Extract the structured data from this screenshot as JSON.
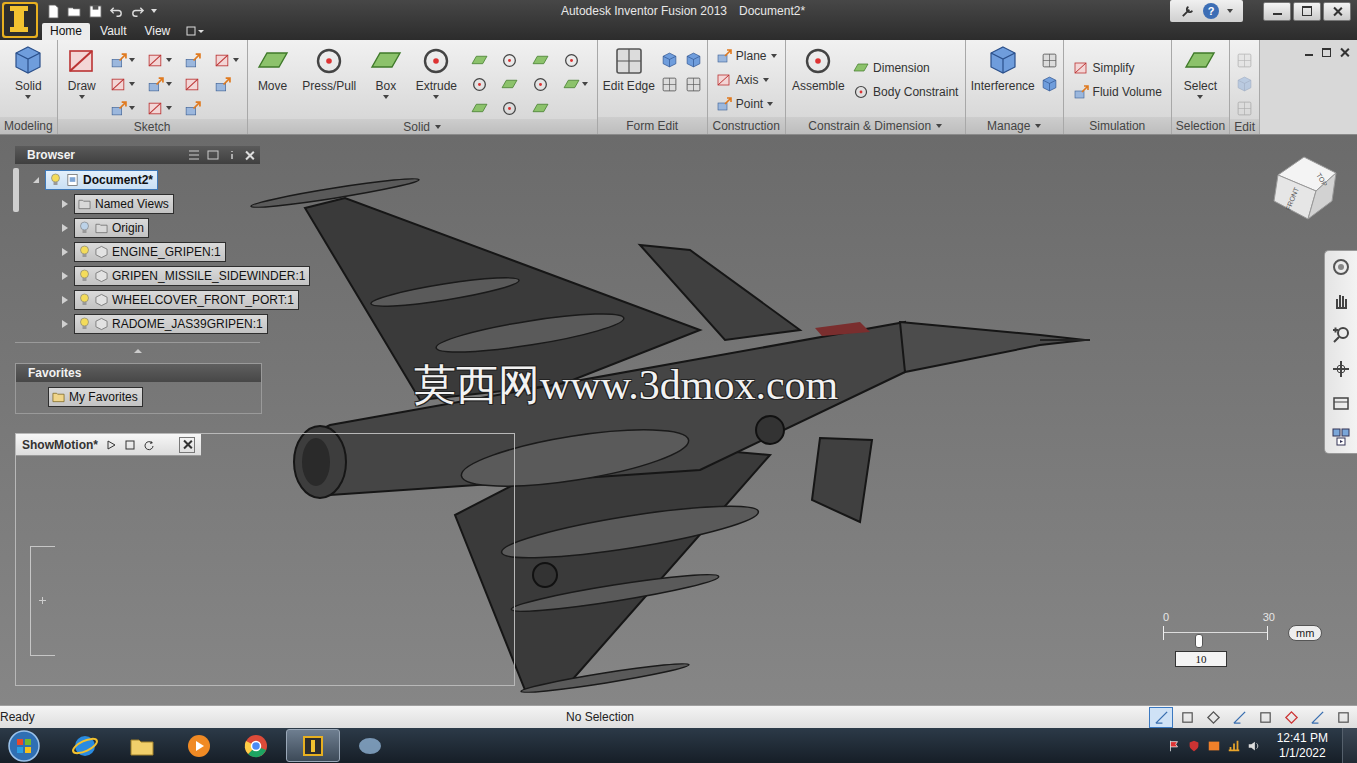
{
  "window": {
    "title": "Autodesk Inventor Fusion 2013",
    "document": "Document2*",
    "help": "?"
  },
  "tabs": [
    {
      "label": "Home",
      "selected": true
    },
    {
      "label": "Vault",
      "selected": false
    },
    {
      "label": "View",
      "selected": false
    }
  ],
  "ribbon": [
    {
      "label": "Modeling",
      "menu": false,
      "buttons": [
        {
          "kind": "large",
          "label": "Solid",
          "dropdown": true,
          "disabled": false
        }
      ]
    },
    {
      "label": "Sketch",
      "menu": false,
      "buttons": [
        {
          "kind": "large",
          "label": "Draw",
          "dropdown": true,
          "disabled": false
        },
        {
          "kind": "icon",
          "dropdown": true,
          "disabled": false
        },
        {
          "kind": "icon",
          "dropdown": true,
          "disabled": false
        },
        {
          "kind": "icon",
          "dropdown": true,
          "disabled": false
        },
        {
          "kind": "icon",
          "dropdown": true,
          "disabled": false
        },
        {
          "kind": "icon",
          "dropdown": true,
          "disabled": false
        },
        {
          "kind": "icon",
          "dropdown": true,
          "disabled": false
        },
        {
          "kind": "icon",
          "dropdown": false,
          "disabled": false
        },
        {
          "kind": "icon",
          "dropdown": false,
          "disabled": false
        },
        {
          "kind": "icon",
          "dropdown": false,
          "disabled": false
        },
        {
          "kind": "icon",
          "dropdown": true,
          "disabled": false
        },
        {
          "kind": "icon",
          "dropdown": false,
          "disabled": false
        }
      ]
    },
    {
      "label": "Solid",
      "menu": true,
      "buttons": [
        {
          "kind": "large",
          "label": "Move",
          "dropdown": false,
          "disabled": false
        },
        {
          "kind": "large",
          "label": "Press/Pull",
          "dropdown": false,
          "disabled": false
        },
        {
          "kind": "large",
          "label": "Box",
          "dropdown": true,
          "disabled": false
        },
        {
          "kind": "large",
          "label": "Extrude",
          "dropdown": true,
          "disabled": false
        },
        {
          "kind": "icon",
          "dropdown": false,
          "disabled": false
        },
        {
          "kind": "icon",
          "dropdown": false,
          "disabled": false
        },
        {
          "kind": "icon",
          "dropdown": false,
          "disabled": false
        },
        {
          "kind": "icon",
          "dropdown": false,
          "disabled": false
        },
        {
          "kind": "icon",
          "dropdown": false,
          "disabled": false
        },
        {
          "kind": "icon",
          "dropdown": false,
          "disabled": false
        },
        {
          "kind": "icon",
          "dropdown": false,
          "disabled": false
        },
        {
          "kind": "icon",
          "dropdown": false,
          "disabled": false
        },
        {
          "kind": "icon",
          "dropdown": false,
          "disabled": false
        },
        {
          "kind": "icon",
          "dropdown": false,
          "disabled": false
        },
        {
          "kind": "icon",
          "dropdown": true,
          "disabled": false
        }
      ]
    },
    {
      "label": "Form Edit",
      "menu": false,
      "buttons": [
        {
          "kind": "large",
          "label": "Edit Edge",
          "dropdown": false,
          "disabled": false
        },
        {
          "kind": "icon",
          "dropdown": false,
          "disabled": false
        },
        {
          "kind": "icon",
          "dropdown": false,
          "disabled": false
        },
        {
          "kind": "icon",
          "dropdown": false,
          "disabled": false
        },
        {
          "kind": "icon",
          "dropdown": false,
          "disabled": false
        }
      ]
    },
    {
      "label": "Construction",
      "menu": false,
      "buttons": [
        {
          "kind": "small",
          "label": "Plane",
          "dropdown": true,
          "disabled": false
        },
        {
          "kind": "small",
          "label": "Axis",
          "dropdown": true,
          "disabled": false
        },
        {
          "kind": "small",
          "label": "Point",
          "dropdown": true,
          "disabled": false
        }
      ]
    },
    {
      "label": "Constrain & Dimension",
      "menu": true,
      "buttons": [
        {
          "kind": "large",
          "label": "Assemble",
          "dropdown": false,
          "disabled": false
        },
        {
          "kind": "small",
          "label": "Dimension",
          "dropdown": false,
          "disabled": false
        },
        {
          "kind": "small",
          "label": "Body Constraint",
          "dropdown": false,
          "disabled": false
        }
      ]
    },
    {
      "label": "Manage",
      "menu": true,
      "buttons": [
        {
          "kind": "large",
          "label": "Interference",
          "dropdown": false,
          "disabled": false
        },
        {
          "kind": "icon",
          "dropdown": false,
          "disabled": false
        },
        {
          "kind": "icon",
          "dropdown": false,
          "disabled": false
        }
      ]
    },
    {
      "label": "Simulation",
      "menu": false,
      "buttons": [
        {
          "kind": "small",
          "label": "Simplify",
          "dropdown": false,
          "disabled": false
        },
        {
          "kind": "small",
          "label": "Fluid Volume",
          "dropdown": false,
          "disabled": false
        }
      ]
    },
    {
      "label": "Selection",
      "menu": false,
      "buttons": [
        {
          "kind": "large",
          "label": "Select",
          "dropdown": true,
          "disabled": false
        }
      ]
    },
    {
      "label": "Edit",
      "menu": false,
      "buttons": [
        {
          "kind": "icon",
          "dropdown": false,
          "disabled": true
        },
        {
          "kind": "icon",
          "dropdown": false,
          "disabled": true
        },
        {
          "kind": "icon",
          "dropdown": false,
          "disabled": true
        }
      ]
    }
  ],
  "browser": {
    "title": "Browser",
    "items": [
      {
        "label": "Document2*",
        "level": 0,
        "kind": "document",
        "expanded": true,
        "selected": true,
        "has_bulb": true,
        "visible": true
      },
      {
        "label": "Named Views",
        "level": 1,
        "kind": "folder",
        "expanded": false,
        "selected": false,
        "has_bulb": false,
        "visible": true
      },
      {
        "label": "Origin",
        "level": 1,
        "kind": "folder",
        "expanded": false,
        "selected": false,
        "has_bulb": true,
        "visible": false
      },
      {
        "label": "ENGINE_GRIPEN:1",
        "level": 1,
        "kind": "part",
        "expanded": false,
        "selected": false,
        "has_bulb": true,
        "visible": true
      },
      {
        "label": "GRIPEN_MISSILE_SIDEWINDER:1",
        "level": 1,
        "kind": "part",
        "expanded": false,
        "selected": false,
        "has_bulb": true,
        "visible": true
      },
      {
        "label": "WHEELCOVER_FRONT_PORT:1",
        "level": 1,
        "kind": "part",
        "expanded": false,
        "selected": false,
        "has_bulb": true,
        "visible": true
      },
      {
        "label": "RADOME_JAS39GRIPEN:1",
        "level": 1,
        "kind": "part",
        "expanded": false,
        "selected": false,
        "has_bulb": true,
        "visible": true
      }
    ]
  },
  "favorites": {
    "title": "Favorites",
    "items": [
      {
        "label": "My Favorites"
      }
    ]
  },
  "showmotion": {
    "title": "ShowMotion*"
  },
  "watermark": "莫西网www.3dmox.com",
  "viewcube": {
    "top": "TOP",
    "front": "FRONT"
  },
  "scale": {
    "min": "0",
    "max": "30",
    "unit": "mm",
    "value": "10",
    "level": 0.33
  },
  "status_bar": {
    "left": "Ready",
    "center": "No Selection",
    "tools": [
      {
        "selected": true
      },
      {
        "selected": false
      },
      {
        "selected": false
      },
      {
        "selected": false
      },
      {
        "selected": false
      },
      {
        "selected": false
      },
      {
        "selected": false
      },
      {
        "selected": false
      }
    ]
  },
  "taskbar": {
    "time": "12:41 PM",
    "date": "1/1/2022",
    "apps": [
      {
        "selected": false
      },
      {
        "selected": false
      },
      {
        "selected": false
      },
      {
        "selected": false
      },
      {
        "selected": true
      },
      {
        "selected": false
      }
    ]
  }
}
